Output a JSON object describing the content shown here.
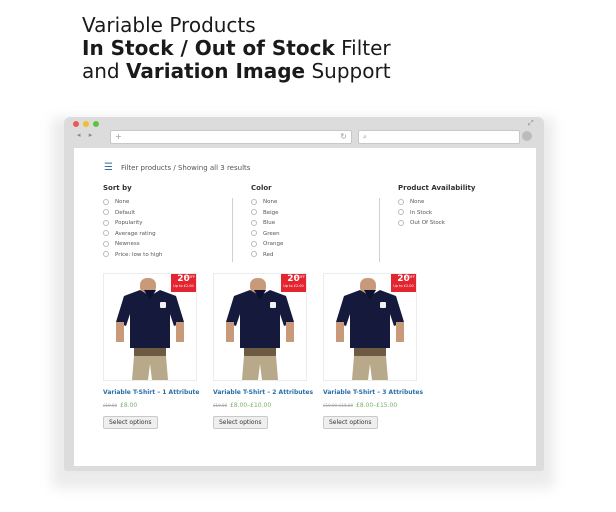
{
  "headline": {
    "line1": "Variable Products",
    "line2_bold": "In Stock / Out of Stock",
    "line2_rest": " Filter",
    "line3_pre": "and ",
    "line3_bold": "Variation Image",
    "line3_rest": " Support"
  },
  "browser": {
    "traffic_lights": [
      "#ec5b53",
      "#f1bd33",
      "#5ec440"
    ],
    "nav_glyphs": "◂ ▸",
    "address_plus": "+",
    "reload_glyph": "↻",
    "search_glyph": "⌕"
  },
  "filter_bar": {
    "menu_glyph": "☰",
    "status": "Filter products / Showing all 3 results"
  },
  "filters": {
    "sort_by": {
      "title": "Sort by",
      "options": [
        "None",
        "Default",
        "Popularity",
        "Average rating",
        "Newness",
        "Price: low to high"
      ]
    },
    "color": {
      "title": "Color",
      "options": [
        "None",
        "Beige",
        "Blue",
        "Green",
        "Orange",
        "Red"
      ]
    },
    "availability": {
      "title": "Product Availability",
      "options": [
        "None",
        "In Stock",
        "Out Of Stock"
      ]
    }
  },
  "products": [
    {
      "title": "Variable T-Shirt – 1 Attribute",
      "old_price": "£10.00",
      "price": "£8.00",
      "button": "Select options",
      "badge": {
        "pct": "20",
        "off": "% OFF",
        "upto": "Up to £2.00"
      }
    },
    {
      "title": "Variable T-Shirt – 2 Attributes",
      "old_price": "£10.00",
      "price": "£8.00–£10.00",
      "button": "Select options",
      "badge": {
        "pct": "20",
        "off": "% OFF",
        "upto": "Up to £2.00"
      }
    },
    {
      "title": "Variable T-Shirt – 3 Attributes",
      "old_price": "£10.00–£15.00",
      "price": "£8.00–£15.00",
      "button": "Select options",
      "badge": {
        "pct": "20",
        "off": "% OFF",
        "upto": "Up to £2.00"
      }
    }
  ],
  "colors": {
    "link_blue": "#2a6fa8",
    "price_green": "#7ab36b",
    "badge_red": "#e32530",
    "shirt_navy": "#151a3d"
  }
}
